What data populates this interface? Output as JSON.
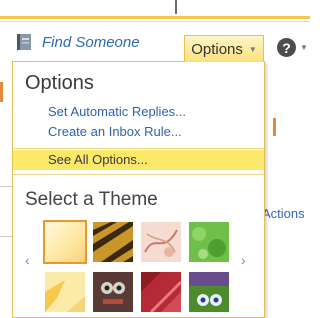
{
  "toolbar": {
    "find_someone": "Find Someone",
    "options_label": "Options",
    "help_label": "?"
  },
  "menu": {
    "heading": "Options",
    "items": [
      {
        "label": "Set Automatic Replies..."
      },
      {
        "label": "Create an Inbox Rule..."
      },
      {
        "label": "See All Options..."
      }
    ],
    "theme_heading": "Select a Theme",
    "themes": [
      {
        "name": "theme-plain-yellow",
        "selected": true
      },
      {
        "name": "theme-tiger-stripes",
        "selected": false
      },
      {
        "name": "theme-sketch-pink",
        "selected": false
      },
      {
        "name": "theme-green-leaves",
        "selected": false
      },
      {
        "name": "theme-yellow-flower",
        "selected": false
      },
      {
        "name": "theme-robot-face",
        "selected": false
      },
      {
        "name": "theme-red-abstract",
        "selected": false
      },
      {
        "name": "theme-purple-monster",
        "selected": false
      }
    ]
  },
  "background": {
    "actions_label": "Actions"
  },
  "colors": {
    "accent_yellow": "#fce86b",
    "link_blue": "#2e62ad",
    "border_gold": "#e0c25a",
    "selected_outline": "#e69a2e"
  }
}
